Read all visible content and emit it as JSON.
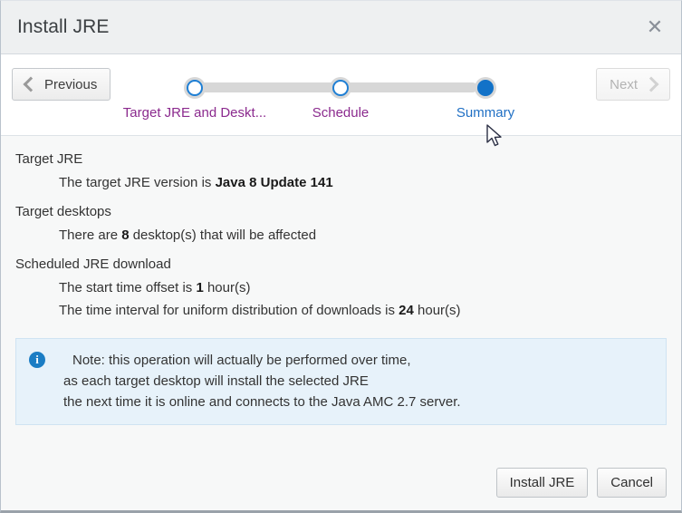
{
  "window": {
    "title": "Install JRE",
    "close_icon": "close-icon"
  },
  "wizard": {
    "previous_label": "Previous",
    "next_label": "Next",
    "steps": [
      {
        "label": "Target JRE and Deskt...",
        "state": "visited"
      },
      {
        "label": "Schedule",
        "state": "visited"
      },
      {
        "label": "Summary",
        "state": "current"
      }
    ]
  },
  "summary": {
    "sections": [
      {
        "title": "Target JRE",
        "lines": [
          {
            "prefix": "The target JRE version is ",
            "strong": "Java 8 Update 141",
            "suffix": ""
          }
        ]
      },
      {
        "title": "Target desktops",
        "lines": [
          {
            "prefix": "There are ",
            "strong": "8",
            "suffix": " desktop(s) that will be affected"
          }
        ]
      },
      {
        "title": "Scheduled JRE download",
        "lines": [
          {
            "prefix": "The start time offset is ",
            "strong": "1",
            "suffix": " hour(s)"
          },
          {
            "prefix": "The time interval for uniform distribution of downloads is ",
            "strong": "24",
            "suffix": " hour(s)"
          }
        ]
      }
    ]
  },
  "note": {
    "icon": "info-icon",
    "line1": "Note:   this operation will actually be performed over time,",
    "line2": "as each target desktop will install the selected JRE",
    "line3": "the next time it is online and connects to the Java AMC 2.7 server."
  },
  "footer": {
    "install_label": "Install JRE",
    "cancel_label": "Cancel"
  },
  "colors": {
    "accent": "#1272c8",
    "visited_step": "#8b2a8e",
    "note_bg": "#e7f2fa",
    "titlebar_bg": "#eef0f1",
    "body_bg": "#f7f8f8"
  }
}
